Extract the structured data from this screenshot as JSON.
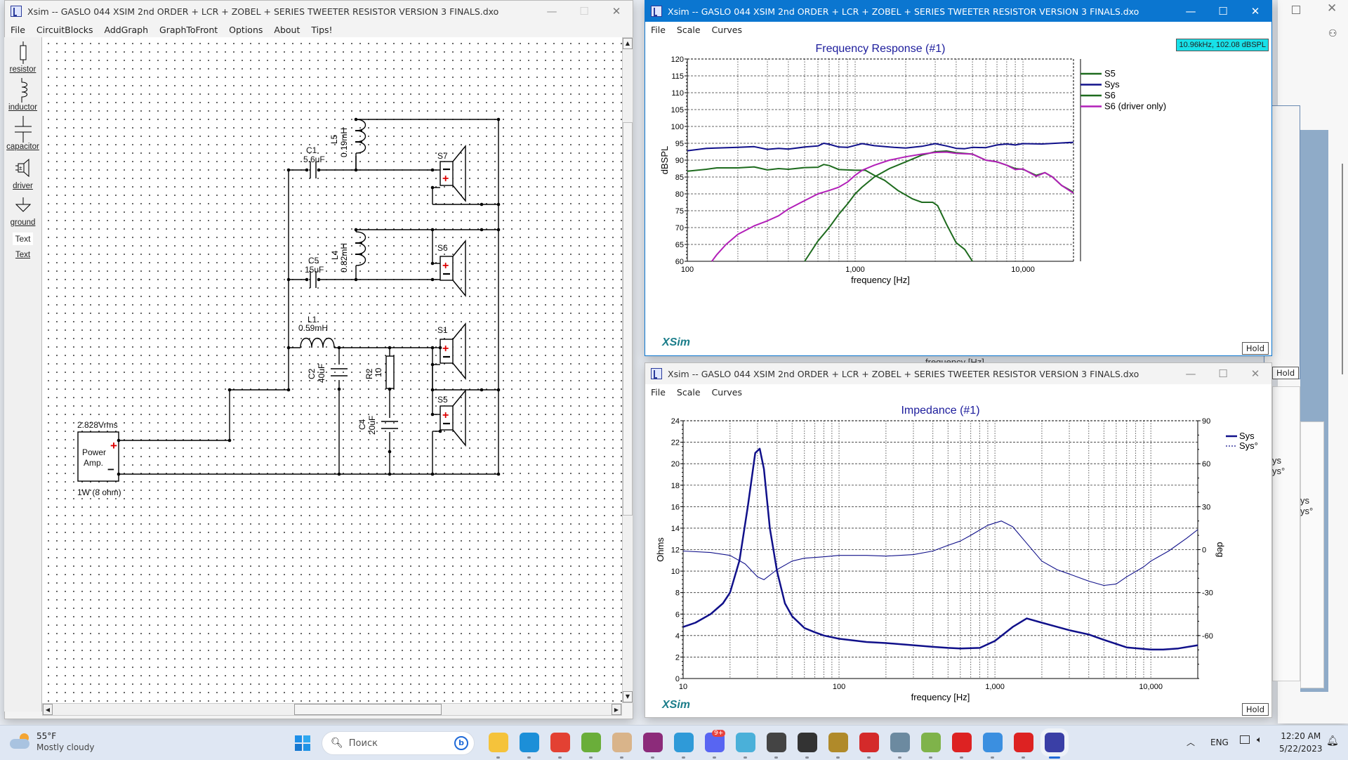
{
  "schematic_window": {
    "title": "Xsim -- GASLO 044 XSIM    2nd ORDER + LCR + ZOBEL + SERIES TWEETER RESISTOR  VERSION 3 FINALS.dxo",
    "menu": [
      "File",
      "CircuitBlocks",
      "AddGraph",
      "GraphToFront",
      "Options",
      "About",
      "Tips!"
    ],
    "toolbox": [
      {
        "label": "resistor",
        "icon": "resistor-icon"
      },
      {
        "label": "inductor",
        "icon": "inductor-icon"
      },
      {
        "label": "capacitor",
        "icon": "capacitor-icon"
      },
      {
        "label": "driver",
        "icon": "driver-icon"
      },
      {
        "label": "ground",
        "icon": "ground-icon"
      },
      {
        "label": "Text",
        "icon": "text-box-icon"
      },
      {
        "label": "Text",
        "icon": "text-icon"
      }
    ],
    "components": {
      "C1": {
        "name": "C1",
        "value": "5.6uF"
      },
      "L5": {
        "name": "L5",
        "value": "0.19mH"
      },
      "C5": {
        "name": "C5",
        "value": "15uF"
      },
      "L4": {
        "name": "L4",
        "value": "0.82mH"
      },
      "L1": {
        "name": "L1",
        "value": "0.59mH"
      },
      "C2": {
        "name": "C2",
        "value": "40uF"
      },
      "R2": {
        "name": "R2",
        "value": "10"
      },
      "C4": {
        "name": "C4",
        "value": "20uF"
      },
      "S7": {
        "name": "S7"
      },
      "S6": {
        "name": "S6"
      },
      "S1": {
        "name": "S1"
      },
      "S5": {
        "name": "S5"
      },
      "amp": {
        "voltage": "2.828Vrms",
        "label1": "Power",
        "label2": "Amp.",
        "power": "1W (8 ohm)",
        "plus": "+",
        "minus": "−"
      }
    }
  },
  "freq_window": {
    "title": "Xsim -- GASLO 044 XSIM    2nd ORDER + LCR + ZOBEL + SERIES TWEETER RESISTOR  VERSION 3 FINALS.dxo",
    "menu": [
      "File",
      "Scale",
      "Curves"
    ],
    "cursor_readout": "10.96kHz, 102.08 dBSPL",
    "hold_label": "Hold",
    "brand": "XSim",
    "overlap_label": "frequency [Hz]"
  },
  "imp_window": {
    "title": "Xsim -- GASLO 044 XSIM    2nd ORDER + LCR + ZOBEL + SERIES TWEETER RESISTOR  VERSION 3 FINALS.dxo",
    "menu": [
      "File",
      "Scale",
      "Curves"
    ],
    "hold_label": "Hold",
    "brand": "XSim"
  },
  "background_windows": {
    "hold_label": "Hold",
    "legend_fragments": [
      "ys",
      "ys°"
    ]
  },
  "chart_data": [
    {
      "type": "line",
      "title": "Frequency Response (#1)",
      "xlabel": "frequency [Hz]",
      "ylabel": "dBSPL",
      "xscale": "log",
      "xlim": [
        100,
        20000
      ],
      "ylim": [
        60,
        120
      ],
      "xticks": [
        {
          "v": 100,
          "l": "100"
        },
        {
          "v": 1000,
          "l": "1,000"
        },
        {
          "v": 10000,
          "l": "10,000"
        }
      ],
      "yticks": [
        60,
        65,
        70,
        75,
        80,
        85,
        90,
        95,
        100,
        105,
        110,
        115,
        120
      ],
      "grid": true,
      "legend": "right",
      "series": [
        {
          "name": "S5",
          "color": "#1e6b1e",
          "points": [
            [
              500,
              60
            ],
            [
              600,
              66
            ],
            [
              700,
              70
            ],
            [
              800,
              74
            ],
            [
              900,
              77
            ],
            [
              1000,
              80
            ],
            [
              1100,
              82
            ],
            [
              1300,
              85
            ],
            [
              1600,
              87.5
            ],
            [
              2000,
              89.5
            ],
            [
              2500,
              91.5
            ],
            [
              3000,
              92.5
            ],
            [
              3500,
              92.7
            ],
            [
              4000,
              92.2
            ],
            [
              5000,
              91.8
            ],
            [
              6000,
              90
            ],
            [
              7000,
              89.5
            ],
            [
              8000,
              88.5
            ],
            [
              9000,
              87.5
            ],
            [
              10000,
              87.3
            ],
            [
              12000,
              85.5
            ],
            [
              13500,
              86.3
            ],
            [
              15000,
              85
            ],
            [
              17000,
              82.5
            ],
            [
              20000,
              80.5
            ]
          ]
        },
        {
          "name": "Sys",
          "color": "#10108a",
          "points": [
            [
              100,
              92.8
            ],
            [
              130,
              93.5
            ],
            [
              200,
              93.8
            ],
            [
              250,
              94
            ],
            [
              300,
              93.2
            ],
            [
              350,
              93.5
            ],
            [
              400,
              93.3
            ],
            [
              500,
              93.9
            ],
            [
              600,
              94.2
            ],
            [
              650,
              95
            ],
            [
              700,
              94.7
            ],
            [
              800,
              93.9
            ],
            [
              900,
              93.8
            ],
            [
              1100,
              94.9
            ],
            [
              1300,
              94.3
            ],
            [
              1700,
              93.8
            ],
            [
              2000,
              93.6
            ],
            [
              2500,
              94.1
            ],
            [
              3000,
              94.9
            ],
            [
              3500,
              94.2
            ],
            [
              4000,
              93.5
            ],
            [
              4500,
              93.4
            ],
            [
              5000,
              93.8
            ],
            [
              6000,
              93.7
            ],
            [
              7000,
              94.5
            ],
            [
              8000,
              94.8
            ],
            [
              9000,
              94.5
            ],
            [
              10000,
              94.9
            ],
            [
              13000,
              94.8
            ],
            [
              17000,
              95.1
            ],
            [
              20000,
              95.3
            ]
          ]
        },
        {
          "name": "S6",
          "color": "#1e6b1e",
          "points": [
            [
              100,
              86.7
            ],
            [
              130,
              87.3
            ],
            [
              150,
              87.7
            ],
            [
              200,
              87.7
            ],
            [
              250,
              88
            ],
            [
              300,
              87.1
            ],
            [
              350,
              87.5
            ],
            [
              400,
              87.3
            ],
            [
              500,
              87.8
            ],
            [
              600,
              87.9
            ],
            [
              650,
              88.7
            ],
            [
              700,
              88.4
            ],
            [
              800,
              87.2
            ],
            [
              1000,
              87
            ],
            [
              1150,
              87
            ],
            [
              1300,
              85.5
            ],
            [
              1500,
              84
            ],
            [
              1800,
              81
            ],
            [
              2200,
              78.5
            ],
            [
              2500,
              77.5
            ],
            [
              2900,
              77.5
            ],
            [
              3100,
              76.5
            ],
            [
              3500,
              71
            ],
            [
              4000,
              65.5
            ],
            [
              4500,
              63.5
            ],
            [
              5000,
              60
            ]
          ]
        },
        {
          "name": "S6 (driver only)",
          "color": "#b21fb8",
          "points": [
            [
              140,
              60
            ],
            [
              150,
              62
            ],
            [
              170,
              65
            ],
            [
              200,
              68
            ],
            [
              250,
              70.5
            ],
            [
              300,
              72
            ],
            [
              350,
              73.5
            ],
            [
              400,
              75.5
            ],
            [
              500,
              78
            ],
            [
              600,
              80
            ],
            [
              700,
              81
            ],
            [
              800,
              82
            ],
            [
              900,
              83.5
            ],
            [
              1000,
              85.5
            ],
            [
              1100,
              87
            ],
            [
              1300,
              88.5
            ],
            [
              1600,
              90
            ],
            [
              2000,
              91
            ],
            [
              2500,
              91.8
            ],
            [
              3000,
              92.3
            ],
            [
              3500,
              92.4
            ],
            [
              4000,
              92
            ],
            [
              5000,
              91.8
            ],
            [
              6000,
              90
            ],
            [
              7000,
              89.5
            ],
            [
              8000,
              88.5
            ],
            [
              9000,
              87.2
            ],
            [
              10000,
              87.4
            ],
            [
              12000,
              85.2
            ],
            [
              13500,
              86.3
            ],
            [
              15000,
              85
            ],
            [
              17000,
              82.5
            ],
            [
              20000,
              80.2
            ]
          ]
        }
      ]
    },
    {
      "type": "line",
      "title": "Impedance (#1)",
      "xlabel": "frequency [Hz]",
      "ylabel": "Ohms",
      "y2label": "deg",
      "xscale": "log",
      "xlim": [
        10,
        20000
      ],
      "ylim": [
        0,
        24
      ],
      "y2lim": [
        -90,
        90
      ],
      "xticks": [
        {
          "v": 10,
          "l": "10"
        },
        {
          "v": 100,
          "l": "100"
        },
        {
          "v": 1000,
          "l": "1,000"
        },
        {
          "v": 10000,
          "l": "10,000"
        }
      ],
      "yticks": [
        0,
        2,
        4,
        6,
        8,
        10,
        12,
        14,
        16,
        18,
        20,
        22,
        24
      ],
      "y2ticks": [
        -60,
        -30,
        0,
        30,
        60,
        90
      ],
      "grid": true,
      "legend": "top-right",
      "series": [
        {
          "name": "Sys",
          "color": "#10108a",
          "axis": "left",
          "dash": false,
          "points": [
            [
              10,
              4.8
            ],
            [
              12,
              5.2
            ],
            [
              15,
              6
            ],
            [
              18,
              7
            ],
            [
              20,
              8
            ],
            [
              23,
              11
            ],
            [
              26,
              16
            ],
            [
              29,
              21
            ],
            [
              31,
              21.4
            ],
            [
              33,
              19.5
            ],
            [
              36,
              14
            ],
            [
              40,
              10
            ],
            [
              45,
              7
            ],
            [
              50,
              5.8
            ],
            [
              60,
              4.7
            ],
            [
              70,
              4.3
            ],
            [
              80,
              4
            ],
            [
              100,
              3.7
            ],
            [
              150,
              3.4
            ],
            [
              200,
              3.3
            ],
            [
              300,
              3.1
            ],
            [
              400,
              2.95
            ],
            [
              500,
              2.85
            ],
            [
              600,
              2.8
            ],
            [
              800,
              2.85
            ],
            [
              1000,
              3.5
            ],
            [
              1300,
              4.8
            ],
            [
              1600,
              5.6
            ],
            [
              2000,
              5.2
            ],
            [
              3000,
              4.5
            ],
            [
              4000,
              4.1
            ],
            [
              5000,
              3.6
            ],
            [
              7000,
              2.9
            ],
            [
              10000,
              2.7
            ],
            [
              12000,
              2.7
            ],
            [
              15000,
              2.8
            ],
            [
              20000,
              3.1
            ]
          ]
        },
        {
          "name": "Sys°",
          "color": "#10108a",
          "axis": "right",
          "dash": true,
          "points": [
            [
              10,
              -1
            ],
            [
              15,
              -2
            ],
            [
              20,
              -4
            ],
            [
              25,
              -10
            ],
            [
              30,
              -19
            ],
            [
              33,
              -21
            ],
            [
              40,
              -14
            ],
            [
              50,
              -8
            ],
            [
              60,
              -6
            ],
            [
              80,
              -5
            ],
            [
              100,
              -4
            ],
            [
              150,
              -4
            ],
            [
              200,
              -4.5
            ],
            [
              300,
              -3.5
            ],
            [
              400,
              -1
            ],
            [
              500,
              3
            ],
            [
              600,
              6
            ],
            [
              700,
              10
            ],
            [
              900,
              17
            ],
            [
              1100,
              20
            ],
            [
              1300,
              16
            ],
            [
              1500,
              8
            ],
            [
              2000,
              -8
            ],
            [
              2500,
              -14
            ],
            [
              3000,
              -17
            ],
            [
              4000,
              -22
            ],
            [
              5000,
              -25
            ],
            [
              6000,
              -24
            ],
            [
              7000,
              -19
            ],
            [
              9000,
              -12
            ],
            [
              10000,
              -8
            ],
            [
              13000,
              -1
            ],
            [
              17000,
              8
            ],
            [
              20000,
              14
            ]
          ]
        }
      ]
    }
  ],
  "taskbar": {
    "weather_temp": "55°F",
    "weather_desc": "Mostly cloudy",
    "search_placeholder": "Поиск",
    "apps": [
      "File Explorer",
      "Edge",
      "Chrome",
      "uTorrent",
      "Tornado",
      "WinRAR",
      "Notepad",
      "Discord",
      "Paint",
      "Speaker",
      "Bass Clef",
      "League of Legends",
      "Superman",
      "Calculator",
      "Notepad++",
      "App 1",
      "Photos",
      "App 2",
      "XSim"
    ],
    "discord_badge": "9+",
    "lang": "ENG",
    "time": "12:20 AM",
    "date": "5/22/2023"
  }
}
